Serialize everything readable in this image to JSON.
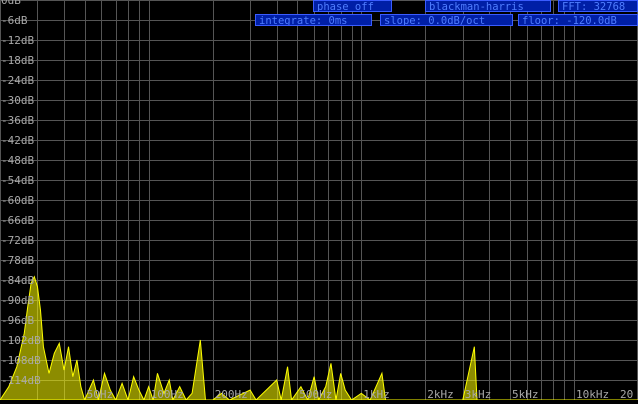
{
  "status": {
    "phase": "phase off",
    "window": "blackman-harris",
    "fft": "FFT: 32768",
    "integrate": "integrate: 0ms",
    "slope": "slope: 0.0dB/oct",
    "floor": "floor: -120.0dB"
  },
  "colors": {
    "background": "#000000",
    "grid": "#555555",
    "label": "#a8a8a8",
    "spectrum": "#ffff00",
    "pill_bg": "#001fa6",
    "pill_text": "#4f7dff"
  },
  "chart_data": {
    "type": "area",
    "x_scale": "log",
    "xlim": [
      20,
      20000
    ],
    "ylim": [
      -120,
      0
    ],
    "y_ticks": [
      {
        "value": 0,
        "label": "0dB"
      },
      {
        "value": -6,
        "label": "-6dB"
      },
      {
        "value": -12,
        "label": "-12dB"
      },
      {
        "value": -18,
        "label": "-18dB"
      },
      {
        "value": -24,
        "label": "-24dB"
      },
      {
        "value": -30,
        "label": "-30dB"
      },
      {
        "value": -36,
        "label": "-36dB"
      },
      {
        "value": -42,
        "label": "-42dB"
      },
      {
        "value": -48,
        "label": "-48dB"
      },
      {
        "value": -54,
        "label": "-54dB"
      },
      {
        "value": -60,
        "label": "-60dB"
      },
      {
        "value": -66,
        "label": "-66dB"
      },
      {
        "value": -72,
        "label": "-72dB"
      },
      {
        "value": -78,
        "label": "-78dB"
      },
      {
        "value": -84,
        "label": "-84dB"
      },
      {
        "value": -90,
        "label": "-90dB"
      },
      {
        "value": -96,
        "label": "-96dB"
      },
      {
        "value": -102,
        "label": "-102dB"
      },
      {
        "value": -108,
        "label": "-108dB"
      },
      {
        "value": -114,
        "label": "-114dB"
      }
    ],
    "x_ticks": [
      {
        "value": 50,
        "label": "50Hz"
      },
      {
        "value": 100,
        "label": "100Hz"
      },
      {
        "value": 200,
        "label": "200Hz"
      },
      {
        "value": 500,
        "label": "500Hz"
      },
      {
        "value": 1000,
        "label": "1kHz"
      },
      {
        "value": 2000,
        "label": "2kHz"
      },
      {
        "value": 3000,
        "label": "3kHz"
      },
      {
        "value": 5000,
        "label": "5kHz"
      },
      {
        "value": 10000,
        "label": "10kHz"
      },
      {
        "value": 20000,
        "label": "20"
      }
    ],
    "grid_freqs": [
      20,
      30,
      40,
      50,
      60,
      70,
      80,
      90,
      100,
      200,
      300,
      400,
      500,
      600,
      700,
      800,
      900,
      1000,
      2000,
      3000,
      4000,
      5000,
      6000,
      7000,
      8000,
      9000,
      10000,
      20000
    ],
    "spectrum": [
      [
        20,
        -120
      ],
      [
        22,
        -116
      ],
      [
        24,
        -110
      ],
      [
        26,
        -100
      ],
      [
        27,
        -92
      ],
      [
        28,
        -85
      ],
      [
        29,
        -83
      ],
      [
        30,
        -86
      ],
      [
        31,
        -93
      ],
      [
        32,
        -104
      ],
      [
        34,
        -112
      ],
      [
        36,
        -106
      ],
      [
        38,
        -103
      ],
      [
        40,
        -111
      ],
      [
        42,
        -104
      ],
      [
        44,
        -113
      ],
      [
        46,
        -108
      ],
      [
        48,
        -116
      ],
      [
        50,
        -120
      ],
      [
        55,
        -114
      ],
      [
        58,
        -120
      ],
      [
        62,
        -112
      ],
      [
        66,
        -117
      ],
      [
        70,
        -120
      ],
      [
        75,
        -115
      ],
      [
        80,
        -120
      ],
      [
        85,
        -113
      ],
      [
        90,
        -117
      ],
      [
        95,
        -120
      ],
      [
        100,
        -116
      ],
      [
        105,
        -120
      ],
      [
        110,
        -112
      ],
      [
        118,
        -118
      ],
      [
        125,
        -114
      ],
      [
        130,
        -120
      ],
      [
        140,
        -116
      ],
      [
        150,
        -120
      ],
      [
        160,
        -118
      ],
      [
        175,
        -102
      ],
      [
        185,
        -120
      ],
      [
        200,
        -120
      ],
      [
        220,
        -118
      ],
      [
        240,
        -120
      ],
      [
        300,
        -117
      ],
      [
        320,
        -120
      ],
      [
        400,
        -114
      ],
      [
        420,
        -120
      ],
      [
        450,
        -110
      ],
      [
        470,
        -120
      ],
      [
        520,
        -116
      ],
      [
        560,
        -120
      ],
      [
        600,
        -113
      ],
      [
        630,
        -120
      ],
      [
        680,
        -116
      ],
      [
        720,
        -109
      ],
      [
        760,
        -120
      ],
      [
        800,
        -112
      ],
      [
        840,
        -117
      ],
      [
        900,
        -120
      ],
      [
        1000,
        -118
      ],
      [
        1100,
        -120
      ],
      [
        1250,
        -112
      ],
      [
        1300,
        -120
      ],
      [
        3000,
        -120
      ],
      [
        3400,
        -104
      ],
      [
        3500,
        -120
      ],
      [
        20000,
        -120
      ]
    ]
  }
}
